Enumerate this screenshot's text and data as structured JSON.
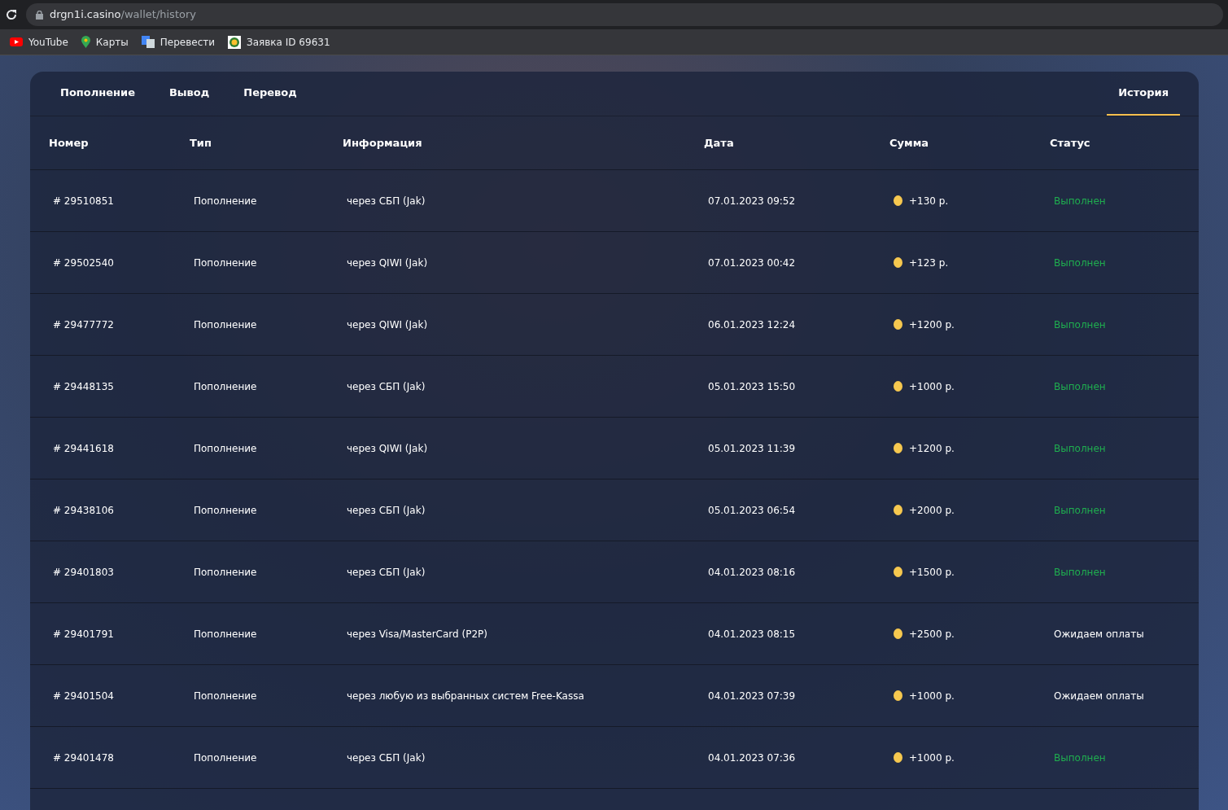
{
  "browser": {
    "url_host": "drgn1i.casino",
    "url_path": "/wallet/history",
    "bookmarks": [
      {
        "label": "YouTube",
        "kind": "youtube"
      },
      {
        "label": "Карты",
        "kind": "maps"
      },
      {
        "label": "Перевести",
        "kind": "translate"
      },
      {
        "label": "Заявка ID 69631",
        "kind": "ticket"
      }
    ]
  },
  "tabs": [
    {
      "label": "Пополнение",
      "selected": false
    },
    {
      "label": "Вывод",
      "selected": false
    },
    {
      "label": "Перевод",
      "selected": false
    },
    {
      "label": "История",
      "selected": true
    }
  ],
  "table": {
    "columns": [
      "Номер",
      "Тип",
      "Информация",
      "Дата",
      "Сумма",
      "Статус"
    ],
    "rows": [
      {
        "number": "# 29510851",
        "type": "Пополнение",
        "info": "через СБП (Jak)",
        "date": "07.01.2023 09:52",
        "amount": "+130 р.",
        "status": {
          "label": "Выполнен",
          "kind": "done"
        }
      },
      {
        "number": "# 29502540",
        "type": "Пополнение",
        "info": "через QIWI (Jak)",
        "date": "07.01.2023 00:42",
        "amount": "+123 р.",
        "status": {
          "label": "Выполнен",
          "kind": "done"
        }
      },
      {
        "number": "# 29477772",
        "type": "Пополнение",
        "info": "через QIWI (Jak)",
        "date": "06.01.2023 12:24",
        "amount": "+1200 р.",
        "status": {
          "label": "Выполнен",
          "kind": "done"
        }
      },
      {
        "number": "# 29448135",
        "type": "Пополнение",
        "info": "через СБП (Jak)",
        "date": "05.01.2023 15:50",
        "amount": "+1000 р.",
        "status": {
          "label": "Выполнен",
          "kind": "done"
        }
      },
      {
        "number": "# 29441618",
        "type": "Пополнение",
        "info": "через QIWI (Jak)",
        "date": "05.01.2023 11:39",
        "amount": "+1200 р.",
        "status": {
          "label": "Выполнен",
          "kind": "done"
        }
      },
      {
        "number": "# 29438106",
        "type": "Пополнение",
        "info": "через СБП (Jak)",
        "date": "05.01.2023 06:54",
        "amount": "+2000 р.",
        "status": {
          "label": "Выполнен",
          "kind": "done"
        }
      },
      {
        "number": "# 29401803",
        "type": "Пополнение",
        "info": "через СБП (Jak)",
        "date": "04.01.2023 08:16",
        "amount": "+1500 р.",
        "status": {
          "label": "Выполнен",
          "kind": "done"
        }
      },
      {
        "number": "# 29401791",
        "type": "Пополнение",
        "info": "через Visa/MasterCard (P2P)",
        "date": "04.01.2023 08:15",
        "amount": "+2500 р.",
        "status": {
          "label": "Ожидаем оплаты",
          "kind": "pending"
        }
      },
      {
        "number": "# 29401504",
        "type": "Пополнение",
        "info": "через любую из выбранных систем Free-Kassa",
        "date": "04.01.2023 07:39",
        "amount": "+1000 р.",
        "status": {
          "label": "Ожидаем оплаты",
          "kind": "pending"
        }
      },
      {
        "number": "# 29401478",
        "type": "Пополнение",
        "info": "через СБП (Jak)",
        "date": "04.01.2023 07:36",
        "amount": "+1000 р.",
        "status": {
          "label": "Выполнен",
          "kind": "done"
        }
      }
    ]
  }
}
